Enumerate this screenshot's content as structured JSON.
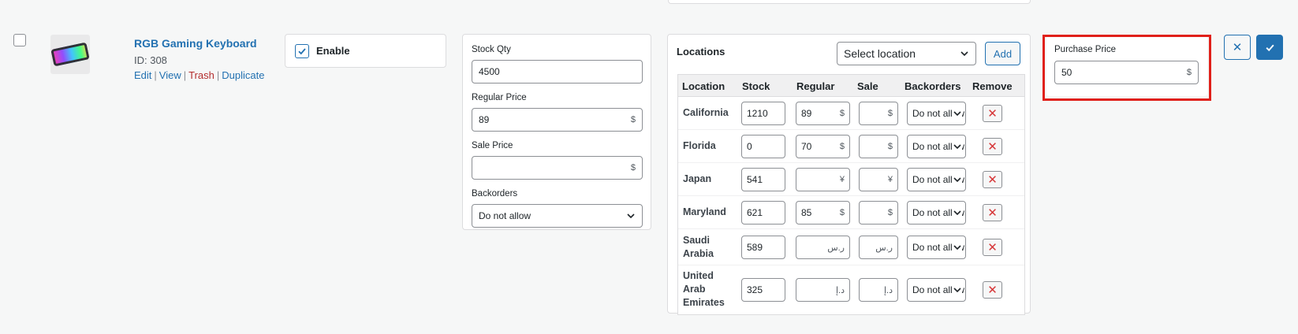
{
  "product": {
    "name": "RGB Gaming Keyboard",
    "id_label": "ID: 308",
    "actions": {
      "edit": "Edit",
      "view": "View",
      "trash": "Trash",
      "duplicate": "Duplicate"
    }
  },
  "enable": {
    "label": "Enable",
    "checked": true
  },
  "stock_panel": {
    "stock_qty_label": "Stock Qty",
    "stock_qty_value": "4500",
    "regular_price_label": "Regular Price",
    "regular_price_value": "89",
    "regular_currency": "$",
    "sale_price_label": "Sale Price",
    "sale_price_value": "",
    "sale_currency": "$",
    "backorders_label": "Backorders",
    "backorders_value": "Do not allow"
  },
  "locations": {
    "title": "Locations",
    "select_placeholder": "Select location",
    "add_label": "Add",
    "columns": {
      "location": "Location",
      "stock": "Stock",
      "regular": "Regular",
      "sale": "Sale",
      "backorders": "Backorders",
      "remove": "Remove"
    },
    "rows": [
      {
        "name": "California",
        "stock": "1210",
        "regular": "89",
        "regular_cur": "$",
        "sale": "",
        "sale_cur": "$",
        "backorders": "Do not allow"
      },
      {
        "name": "Florida",
        "stock": "0",
        "regular": "70",
        "regular_cur": "$",
        "sale": "",
        "sale_cur": "$",
        "backorders": "Do not allow"
      },
      {
        "name": "Japan",
        "stock": "541",
        "regular": "",
        "regular_cur": "¥",
        "sale": "",
        "sale_cur": "¥",
        "backorders": "Do not allow"
      },
      {
        "name": "Maryland",
        "stock": "621",
        "regular": "85",
        "regular_cur": "$",
        "sale": "",
        "sale_cur": "$",
        "backorders": "Do not allow"
      },
      {
        "name": "Saudi Arabia",
        "stock": "589",
        "regular": "",
        "regular_cur": "ر.س",
        "sale": "",
        "sale_cur": "ر.س",
        "backorders": "Do not allow"
      },
      {
        "name": "United Arab Emirates",
        "stock": "325",
        "regular": "",
        "regular_cur": "د.إ",
        "sale": "",
        "sale_cur": "د.إ",
        "backorders": "Do not allow"
      }
    ]
  },
  "purchase_price": {
    "label": "Purchase Price",
    "value": "50",
    "currency": "$"
  },
  "controls": {
    "cancel_icon": "close-icon",
    "save_icon": "checkmark-icon"
  },
  "colors": {
    "link": "#2271b1",
    "trash": "#b32d2e",
    "primary": "#2271b1",
    "highlight": "#e0201a",
    "remove": "#d63638"
  }
}
